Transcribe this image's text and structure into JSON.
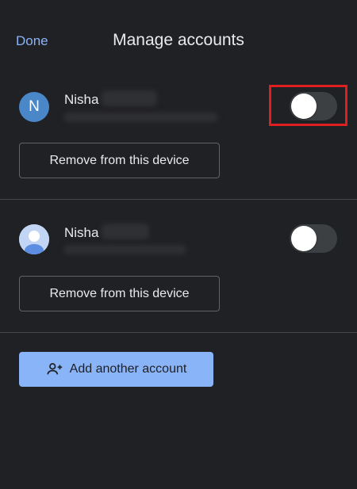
{
  "header": {
    "done_label": "Done",
    "title": "Manage accounts"
  },
  "accounts": [
    {
      "avatar_letter": "N",
      "avatar_type": "letter",
      "name": "Nisha",
      "toggle_on": false,
      "remove_label": "Remove from this device"
    },
    {
      "avatar_type": "person-icon",
      "name": "Nisha",
      "toggle_on": false,
      "remove_label": "Remove from this device"
    }
  ],
  "add_account": {
    "label": "Add another account",
    "icon": "person-add-icon"
  },
  "colors": {
    "background": "#202124",
    "accent": "#8ab4f8",
    "avatar_blue": "#4a87c8",
    "highlight": "#e02020"
  }
}
